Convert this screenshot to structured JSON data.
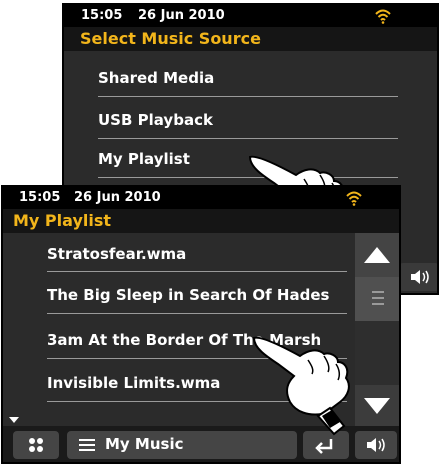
{
  "back_screen": {
    "status": {
      "time": "15:05",
      "date": "26 Jun 2010"
    },
    "title": "Select Music Source",
    "items": [
      {
        "label": "Shared Media"
      },
      {
        "label": "USB Playback"
      },
      {
        "label": "My Playlist"
      }
    ]
  },
  "front_screen": {
    "status": {
      "time": "15:05",
      "date": "26 Jun 2010"
    },
    "title": "My Playlist",
    "items": [
      {
        "label": "Stratosfear.wma"
      },
      {
        "label": "The Big Sleep in Search Of Hades"
      },
      {
        "label": "3am At the Border Of The Marsh"
      },
      {
        "label": "Invisible Limits.wma"
      }
    ],
    "bottom": {
      "menu_label": "My Music"
    }
  },
  "colors": {
    "title_text": "#f2b51b",
    "wifi": "#f2b51b",
    "screen_bg": "#2b2b2b"
  },
  "icons": [
    "wifi-icon",
    "pointing-hand-icon",
    "scroll-up-icon",
    "scroll-down-icon",
    "grid-icon",
    "menu-icon",
    "back-icon",
    "volume-icon"
  ]
}
